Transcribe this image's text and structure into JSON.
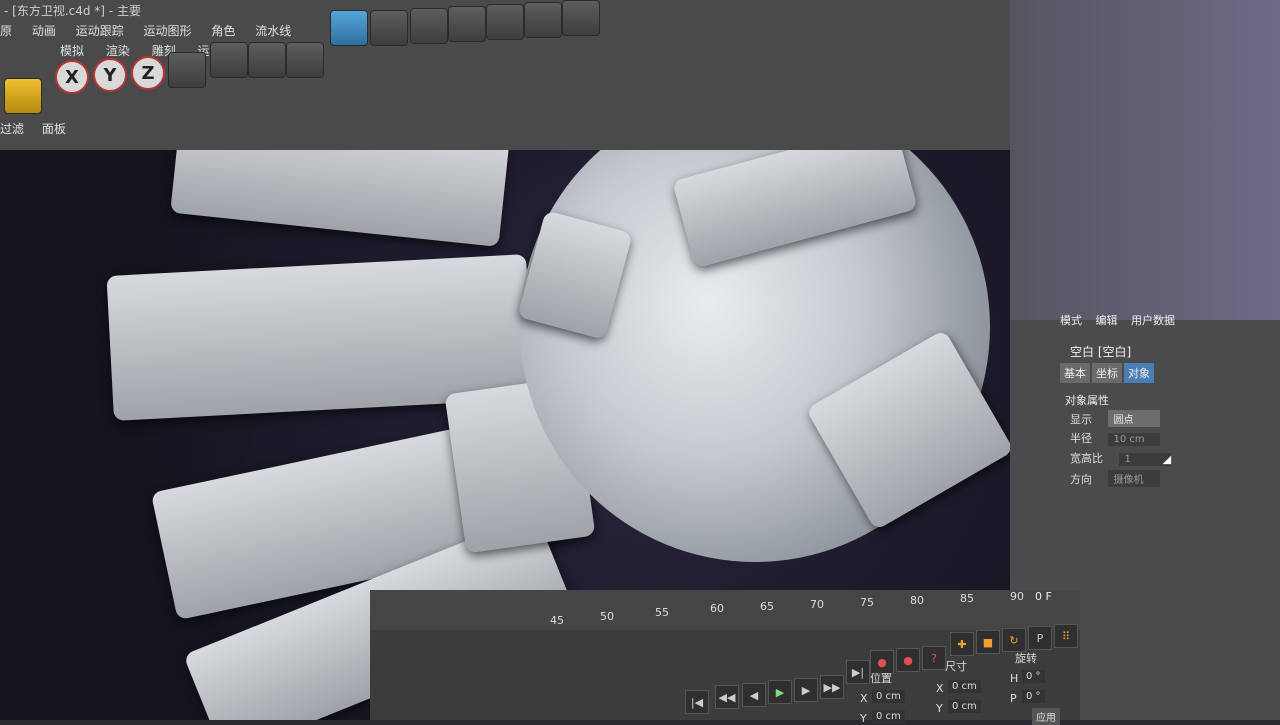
{
  "window": {
    "title": "- [东方卫视.c4d *] - 主要"
  },
  "menu": {
    "items": [
      "原",
      "动画",
      "运动跟踪",
      "运动图形",
      "角色",
      "流水线"
    ]
  },
  "menu_row2": {
    "items": [
      "模拟",
      "渲染",
      "雕刻",
      "运动跟踪"
    ]
  },
  "left_tabs": {
    "items": [
      "过滤",
      "面板"
    ]
  },
  "axis_buttons": {
    "x": "X",
    "y": "Y",
    "z": "Z"
  },
  "attributes": {
    "tabs": [
      "模式",
      "编辑",
      "用户数据"
    ],
    "object_name": "空白 [空白]",
    "subtabs": [
      "基本",
      "坐标",
      "对象"
    ],
    "active_subtab": "对象",
    "section_title": "对象属性",
    "props": [
      {
        "label": "显示",
        "value": "圆点"
      },
      {
        "label": "半径",
        "value": "10 cm"
      },
      {
        "label": "宽高比",
        "value": "1"
      },
      {
        "label": "方向",
        "value": "摄像机"
      }
    ]
  },
  "timeline": {
    "ticks": [
      "45",
      "50",
      "55",
      "60",
      "65",
      "70",
      "75",
      "80",
      "85",
      "90"
    ],
    "frame_label": "0 F"
  },
  "coordinates": {
    "header_position": "位置",
    "header_size": "尺寸",
    "header_rotation": "旋转",
    "rows": [
      {
        "axis": "X",
        "pos": "0 cm",
        "size_axis": "X",
        "size": "0 cm",
        "rot_axis": "H",
        "rot": "0 °"
      },
      {
        "axis": "Y",
        "pos": "0 cm",
        "size_axis": "Y",
        "size": "0 cm",
        "rot_axis": "P",
        "rot": "0 °"
      }
    ],
    "apply_label": "应用"
  },
  "colors": {
    "accent": "#4a7fb5",
    "panel_bg": "#4b4b4e",
    "viewport_bg": "#15131e"
  }
}
